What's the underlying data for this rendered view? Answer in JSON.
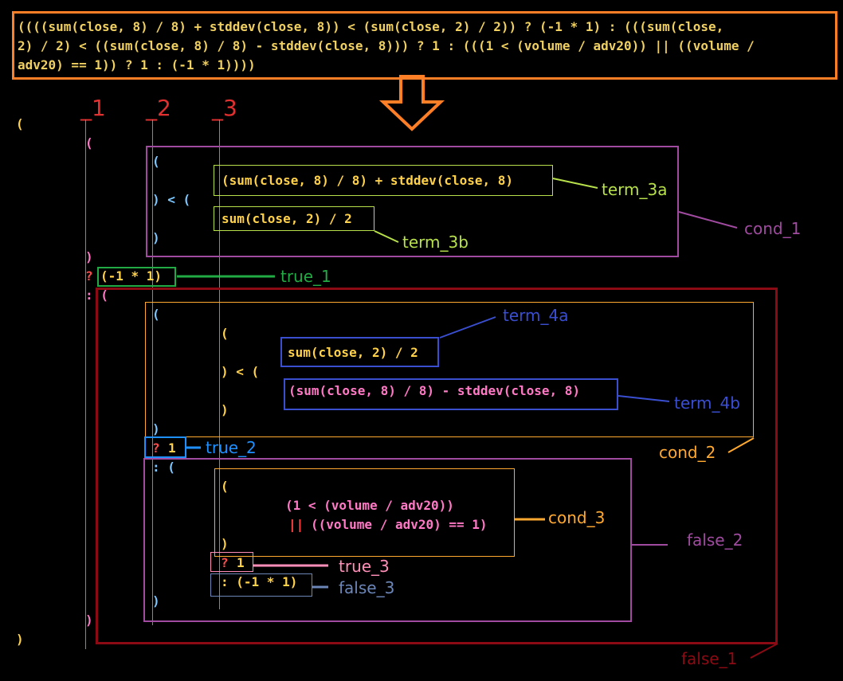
{
  "formula": {
    "line1": "((((sum(close, 8) / 8) + stddev(close, 8)) < (sum(close, 2) / 2)) ? (-1 * 1) : (((sum(close,",
    "line2": "2) / 2) < ((sum(close, 8) / 8) - stddev(close, 8))) ? 1 : (((1 < (volume / adv20)) || ((volume /",
    "line3": "adv20) == 1)) ? 1 : (-1 * 1))))"
  },
  "columns": {
    "col1": "_1",
    "col2": "_2",
    "col3": "_3"
  },
  "code": {
    "open_outer": "(",
    "open_1": "(",
    "open_cond1": "(",
    "term_3a": "(sum(close, 8) / 8) + stddev(close, 8)",
    "lt_1": ") < (",
    "term_3b": "sum(close, 2) / 2",
    "close_cond1": ")",
    "close_1": ")",
    "q1": "?",
    "true_1": "(-1 * 1)",
    "colon_1": ": (",
    "open_cond2": "(",
    "open_term4": "(",
    "term_4a": "sum(close, 2) / 2",
    "lt_2": ") < (",
    "term_4b": "(sum(close, 8) / 8) - stddev(close, 8)",
    "close_term4": ")",
    "close_cond2": ")",
    "q2": "?",
    "true_2": "1",
    "colon_2": ": (",
    "open_cond3": "(",
    "cond3_l1": "(1 < (volume / adv20))",
    "cond3_or": "||",
    "cond3_l2": "((volume / adv20) == 1)",
    "close_cond3": ")",
    "q3": "?",
    "true_3": "1",
    "false_3": ": (-1 * 1)",
    "close_false2": ")",
    "close_false1": ")",
    "close_outer": ")"
  },
  "labels": {
    "term_3a": "term_3a",
    "term_3b": "term_3b",
    "cond_1": "cond_1",
    "true_1": "true_1",
    "term_4a": "term_4a",
    "term_4b": "term_4b",
    "true_2": "true_2",
    "cond_2": "cond_2",
    "cond_3": "cond_3",
    "false_2": "false_2",
    "true_3": "true_3",
    "false_3": "false_3",
    "false_1": "false_1"
  },
  "colors": {
    "orange": "#ff7f27",
    "purple": "#a04aa0",
    "darkred": "#8b0a14",
    "green": "#22aa44",
    "blue": "#3a4ed0",
    "cyan": "#1e90ff",
    "lime": "#b7e04a",
    "gold": "#ffa931",
    "pink": "#ff8fb8",
    "steel": "#6c86b8",
    "red": "#e03030"
  }
}
